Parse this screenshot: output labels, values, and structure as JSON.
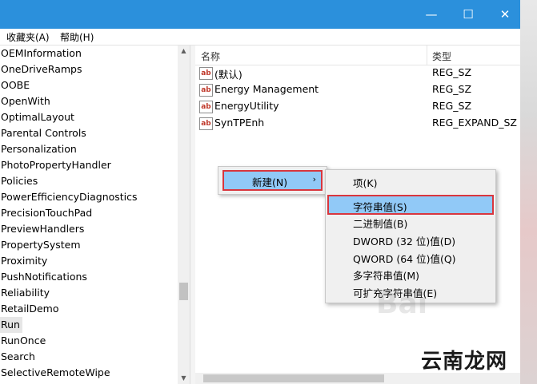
{
  "window": {
    "minimize": "—",
    "maximize": "☐",
    "close": "✕"
  },
  "menubar": {
    "favorites": "收藏夹(A)",
    "help": "帮助(H)"
  },
  "tree": {
    "items": [
      "OEMInformation",
      "OneDriveRamps",
      "OOBE",
      "OpenWith",
      "OptimalLayout",
      "Parental Controls",
      "Personalization",
      "PhotoPropertyHandler",
      "Policies",
      "PowerEfficiencyDiagnostics",
      "PrecisionTouchPad",
      "PreviewHandlers",
      "PropertySystem",
      "Proximity",
      "PushNotifications",
      "Reliability",
      "RetailDemo",
      "Run",
      "RunOnce",
      "Search",
      "SelectiveRemoteWipe"
    ],
    "selected": "Run"
  },
  "list": {
    "col_name": "名称",
    "col_type": "类型",
    "icon_text": "ab",
    "rows": [
      {
        "name": "(默认)",
        "type": "REG_SZ"
      },
      {
        "name": "Energy Management",
        "type": "REG_SZ"
      },
      {
        "name": "EnergyUtility",
        "type": "REG_SZ"
      },
      {
        "name": "SynTPEnh",
        "type": "REG_EXPAND_SZ"
      }
    ]
  },
  "context_menu": {
    "new_label": "新建(N)",
    "arrow": "›"
  },
  "submenu": {
    "items": [
      "项(K)",
      "字符串值(S)",
      "二进制值(B)",
      "DWORD (32 位)值(D)",
      "QWORD (64 位)值(Q)",
      "多字符串值(M)",
      "可扩充字符串值(E)"
    ],
    "highlighted": "字符串值(S)"
  },
  "watermark": {
    "text": "云南龙网"
  },
  "colors": {
    "titlebar": "#2b90dc",
    "highlight": "#91c9f7",
    "annotation_red": "#d9363e"
  }
}
